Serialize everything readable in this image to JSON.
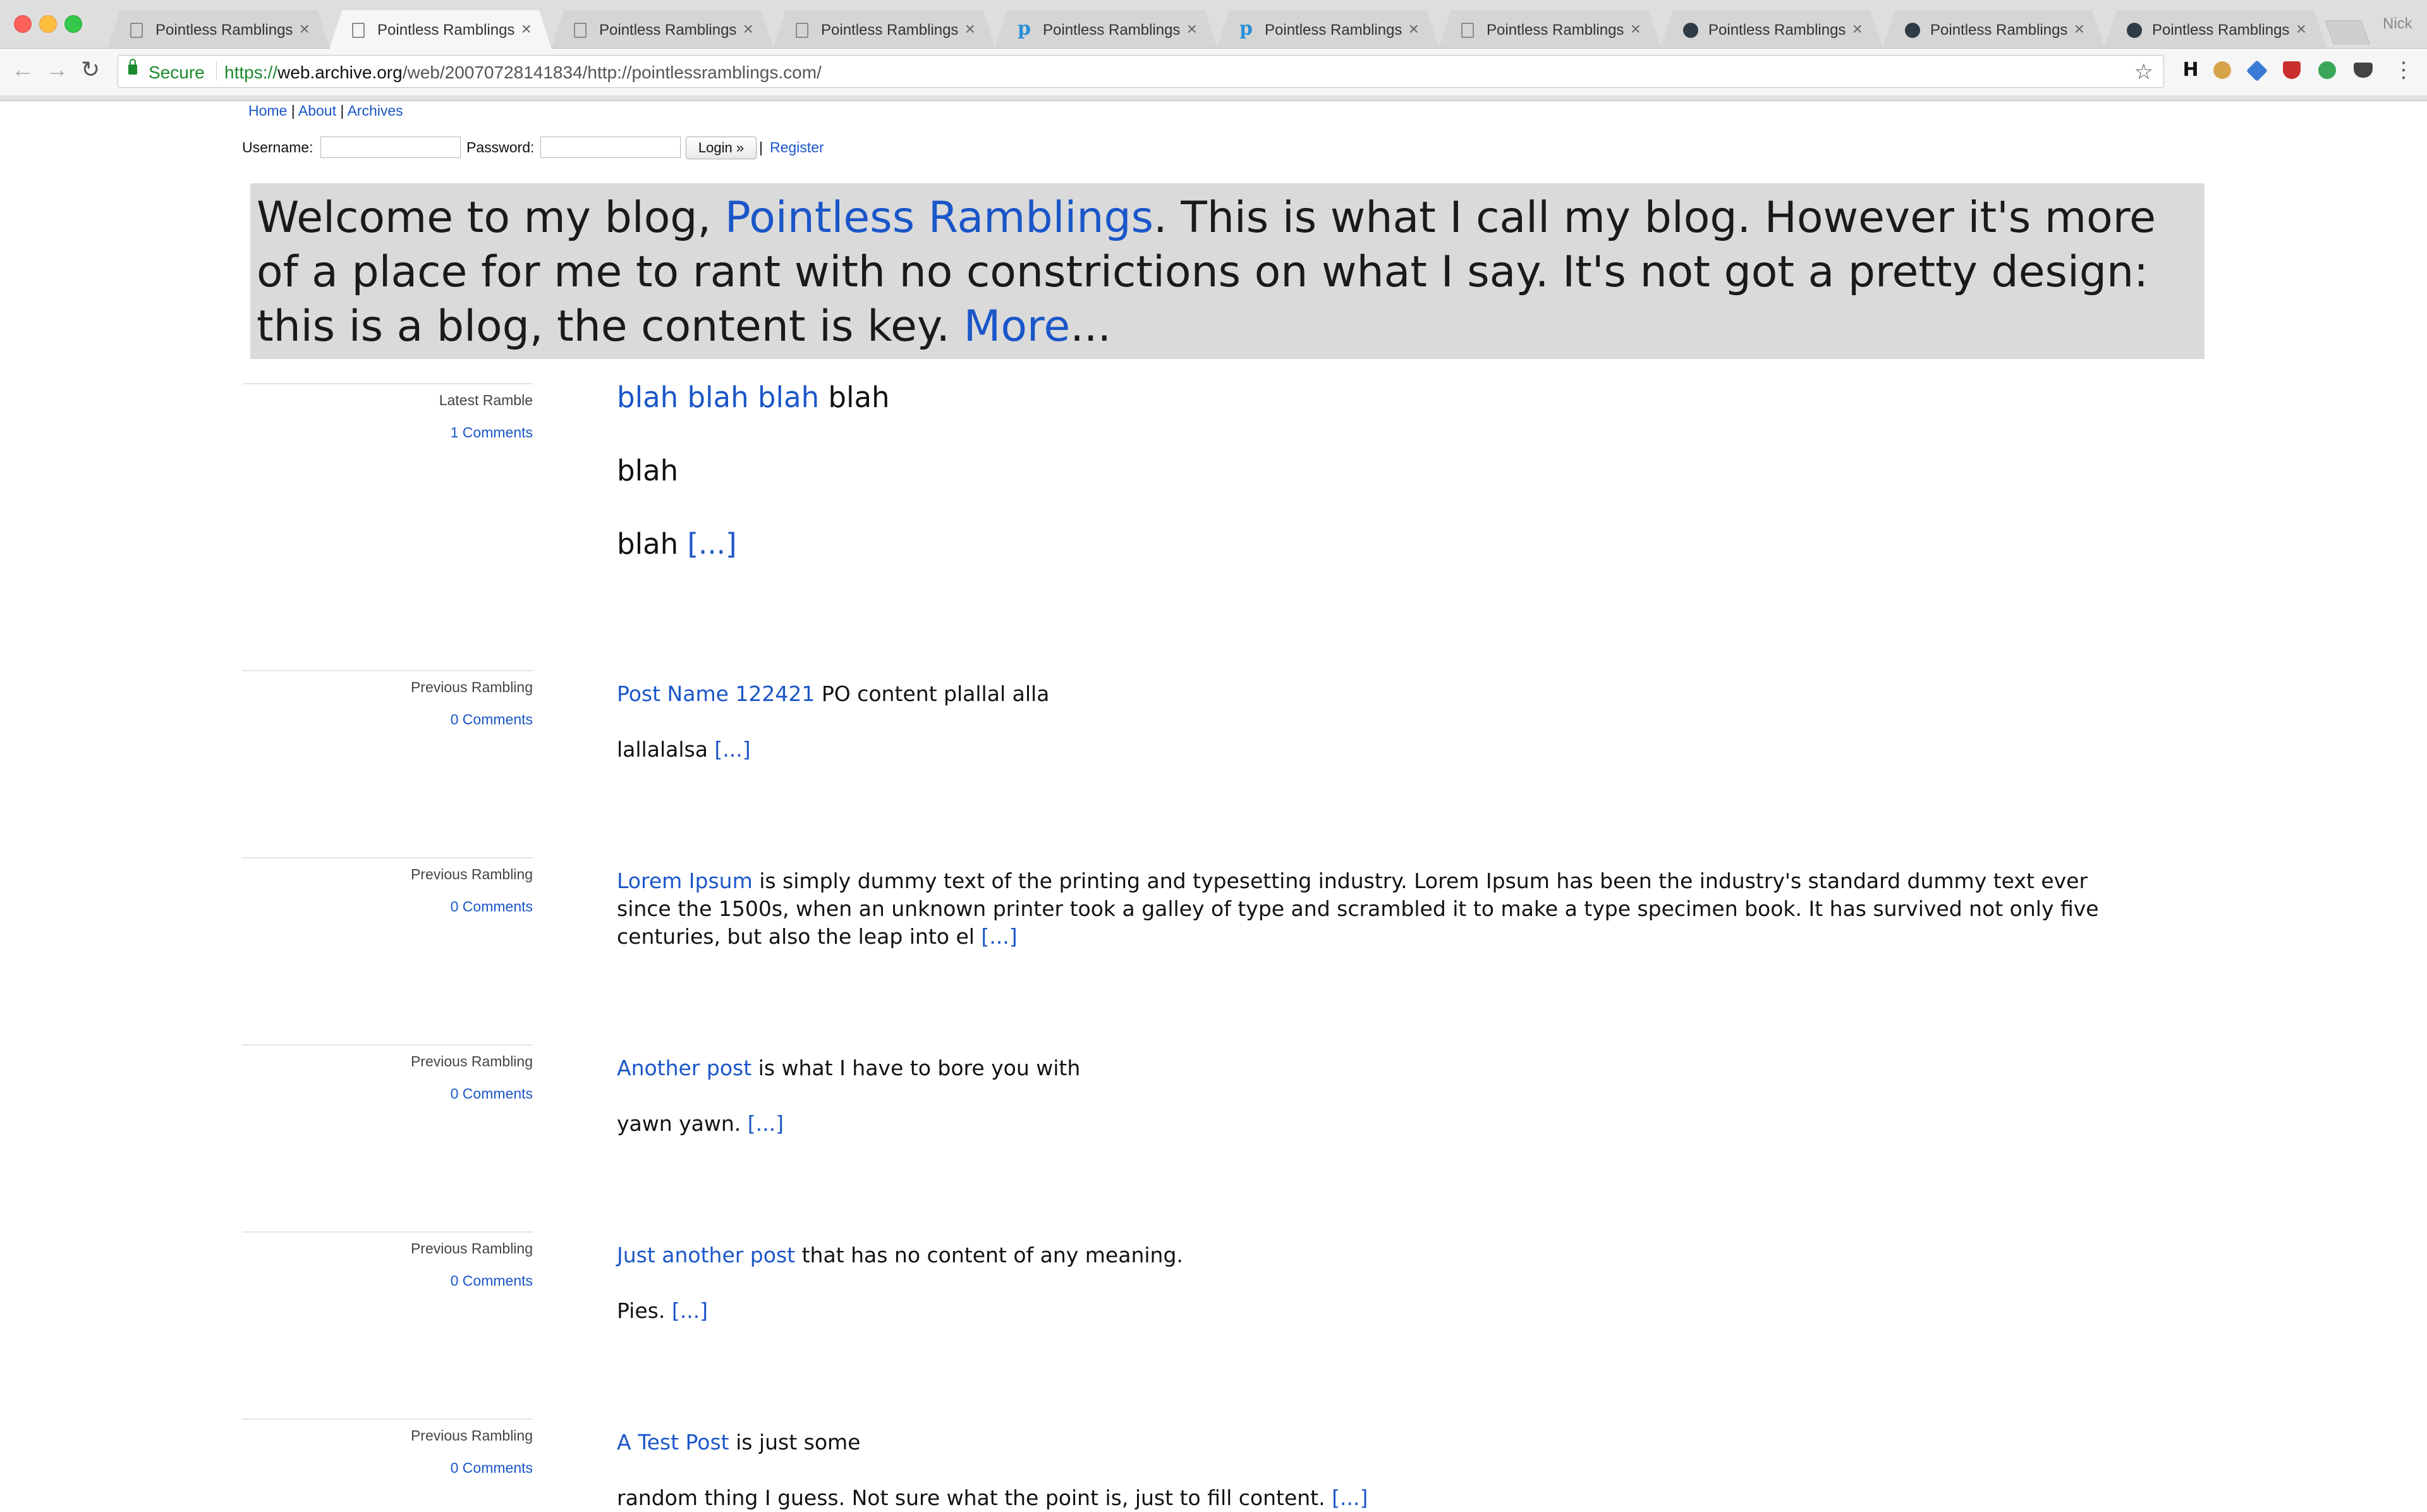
{
  "browser": {
    "tabs": [
      {
        "title": "Pointless Ramblings",
        "favicon": "document-icon"
      },
      {
        "title": "Pointless Ramblings",
        "favicon": "document-icon",
        "active": true
      },
      {
        "title": "Pointless Ramblings",
        "favicon": "document-icon"
      },
      {
        "title": "Pointless Ramblings",
        "favicon": "document-icon"
      },
      {
        "title": "Pointless Ramblings",
        "favicon": "p-logo-icon"
      },
      {
        "title": "Pointless Ramblings",
        "favicon": "p-logo-icon"
      },
      {
        "title": "Pointless Ramblings",
        "favicon": "document-icon"
      },
      {
        "title": "Pointless Ramblings",
        "favicon": "archive-logo-icon"
      },
      {
        "title": "Pointless Ramblings",
        "favicon": "archive-logo-icon"
      },
      {
        "title": "Pointless Ramblings",
        "favicon": "archive-logo-icon"
      }
    ],
    "profile_name": "Nick",
    "security_label": "Secure",
    "url": {
      "scheme": "https://",
      "host": "web.archive.org",
      "path": "/web/20070728141834/http://pointlessramblings.com/"
    },
    "extensions": [
      "h-icon",
      "cookie-icon",
      "blue-ext-icon",
      "shield-badge-icon",
      "green-badge-icon",
      "pocket-icon"
    ],
    "accent": "#1a8a2f"
  },
  "site": {
    "nav": {
      "home": "Home",
      "about": "About",
      "archives": "Archives",
      "sep": "|"
    },
    "login": {
      "username_label": "Username:",
      "password_label": "Password:",
      "username_value": "",
      "password_value": "",
      "login_button": "Login »",
      "register": "Register",
      "sep": "|"
    },
    "hero": {
      "text_before": "Welcome to my blog, ",
      "link_blog": "Pointless Ramblings",
      "text_middle": ". This is what I call my blog. However it's more of a place for me to rant with no constrictions on what I say. It's not got a pretty design: this is a blog, the content is key. ",
      "link_more": "More",
      "text_after": "...",
      "background": "#dadada"
    },
    "link_color": "#1a56c8",
    "posts": [
      {
        "kind": "Latest Ramble",
        "comments": "1 Comments",
        "title": "blah blah blah",
        "lead": " blah",
        "paras": [
          "blah"
        ],
        "last": "blah ",
        "more": "[...]"
      },
      {
        "kind": "Previous Rambling",
        "comments": "0 Comments",
        "title": "Post Name 122421",
        "lead": " PO content plallal alla",
        "paras": [],
        "last": "lallalalsa ",
        "more": "[...]"
      },
      {
        "kind": "Previous Rambling",
        "comments": "0 Comments",
        "title": "Lorem Ipsum",
        "lead": " is simply dummy text of the printing and typesetting industry. Lorem Ipsum has been the industry's standard dummy text ever since the 1500s, when an unknown printer took a galley of type and scrambled it to make a type specimen book. It has survived not only five centuries, but also the leap into el ",
        "paras": [],
        "last": "",
        "more": "[...]"
      },
      {
        "kind": "Previous Rambling",
        "comments": "0 Comments",
        "title": "Another post",
        "lead": " is what I have to bore you with",
        "paras": [],
        "last": "yawn yawn. ",
        "more": "[...]"
      },
      {
        "kind": "Previous Rambling",
        "comments": "0 Comments",
        "title": "Just another post",
        "lead": " that has no content of any meaning.",
        "paras": [],
        "last": "Pies. ",
        "more": "[...]"
      },
      {
        "kind": "Previous Rambling",
        "comments": "0 Comments",
        "title": "A Test Post",
        "lead": " is just some",
        "paras": [],
        "last": "random thing I guess. Not sure what the point is, just to fill content. ",
        "more": "[...]"
      }
    ]
  }
}
